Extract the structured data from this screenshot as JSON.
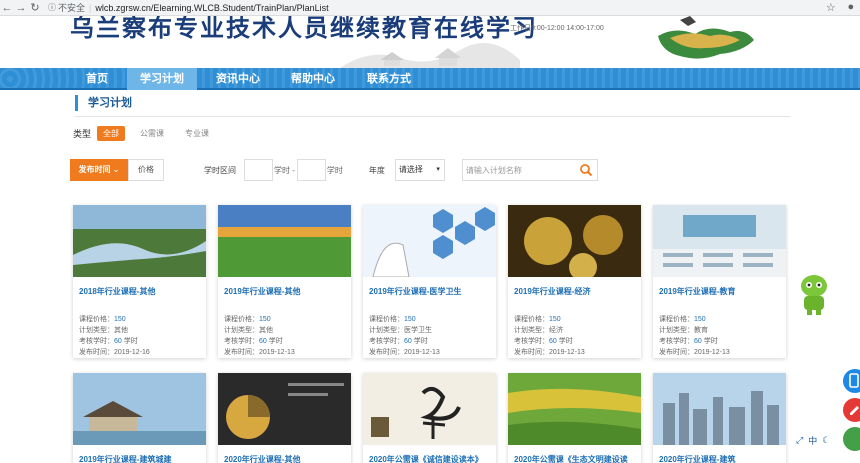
{
  "browser": {
    "security_label": "不安全",
    "url": "wlcb.zgrsw.cn/Elearning.WLCB.Student/TrainPlan/PlanList"
  },
  "header": {
    "site_title": "乌兰察布专业技术人员继续教育在线学习",
    "work_hours": "工作日9:00-12:00   14:00-17:00"
  },
  "nav": {
    "items": [
      {
        "label": "首页",
        "active": false
      },
      {
        "label": "学习计划",
        "active": true
      },
      {
        "label": "资讯中心",
        "active": false
      },
      {
        "label": "帮助中心",
        "active": false
      },
      {
        "label": "联系方式",
        "active": false
      }
    ]
  },
  "section": {
    "title": "学习计划"
  },
  "type_filter": {
    "label": "类型",
    "chips": [
      {
        "label": "全部",
        "active": true
      },
      {
        "label": "公需课",
        "active": false
      },
      {
        "label": "专业课",
        "active": false
      }
    ]
  },
  "filters": {
    "sort_label": "发布时间",
    "price_label": "价格",
    "hours_label": "学时区间",
    "hours_unit_from": "学时 -",
    "hours_unit_to": "学时",
    "year_label": "年度",
    "year_select": "请选择",
    "search_placeholder": "请输入计划名称"
  },
  "card_labels": {
    "price": "课程价格：",
    "plan_type": "计划类型：",
    "hours": "考核学时：",
    "publish": "发布时间：",
    "hours_suffix": "学时"
  },
  "cards": [
    {
      "title": "2018年行业课程-其他",
      "price": "150",
      "type": "其他",
      "hours": "60",
      "date": "2019-12-16"
    },
    {
      "title": "2019年行业课程-其他",
      "price": "150",
      "type": "其他",
      "hours": "60",
      "date": "2019-12-13"
    },
    {
      "title": "2019年行业课程-医学卫生",
      "price": "150",
      "type": "医学卫生",
      "hours": "60",
      "date": "2019-12-13"
    },
    {
      "title": "2019年行业课程-经济",
      "price": "150",
      "type": "经济",
      "hours": "60",
      "date": "2019-12-13"
    },
    {
      "title": "2019年行业课程-教育",
      "price": "150",
      "type": "教育",
      "hours": "60",
      "date": "2019-12-13"
    },
    {
      "title": "2019年行业课程-建筑城建"
    },
    {
      "title": "2020年行业课程-其他"
    },
    {
      "title": "2020年公需课《诚信建设读本》"
    },
    {
      "title": "2020年公需课《生态文明建设读"
    },
    {
      "title": "2020年行业课程-建筑"
    }
  ],
  "lang_bar": {
    "lang": "中"
  },
  "colors": {
    "nav_blue": "#2e8fd6",
    "accent_orange": "#f07b1e",
    "link_blue": "#1f6fb5"
  }
}
